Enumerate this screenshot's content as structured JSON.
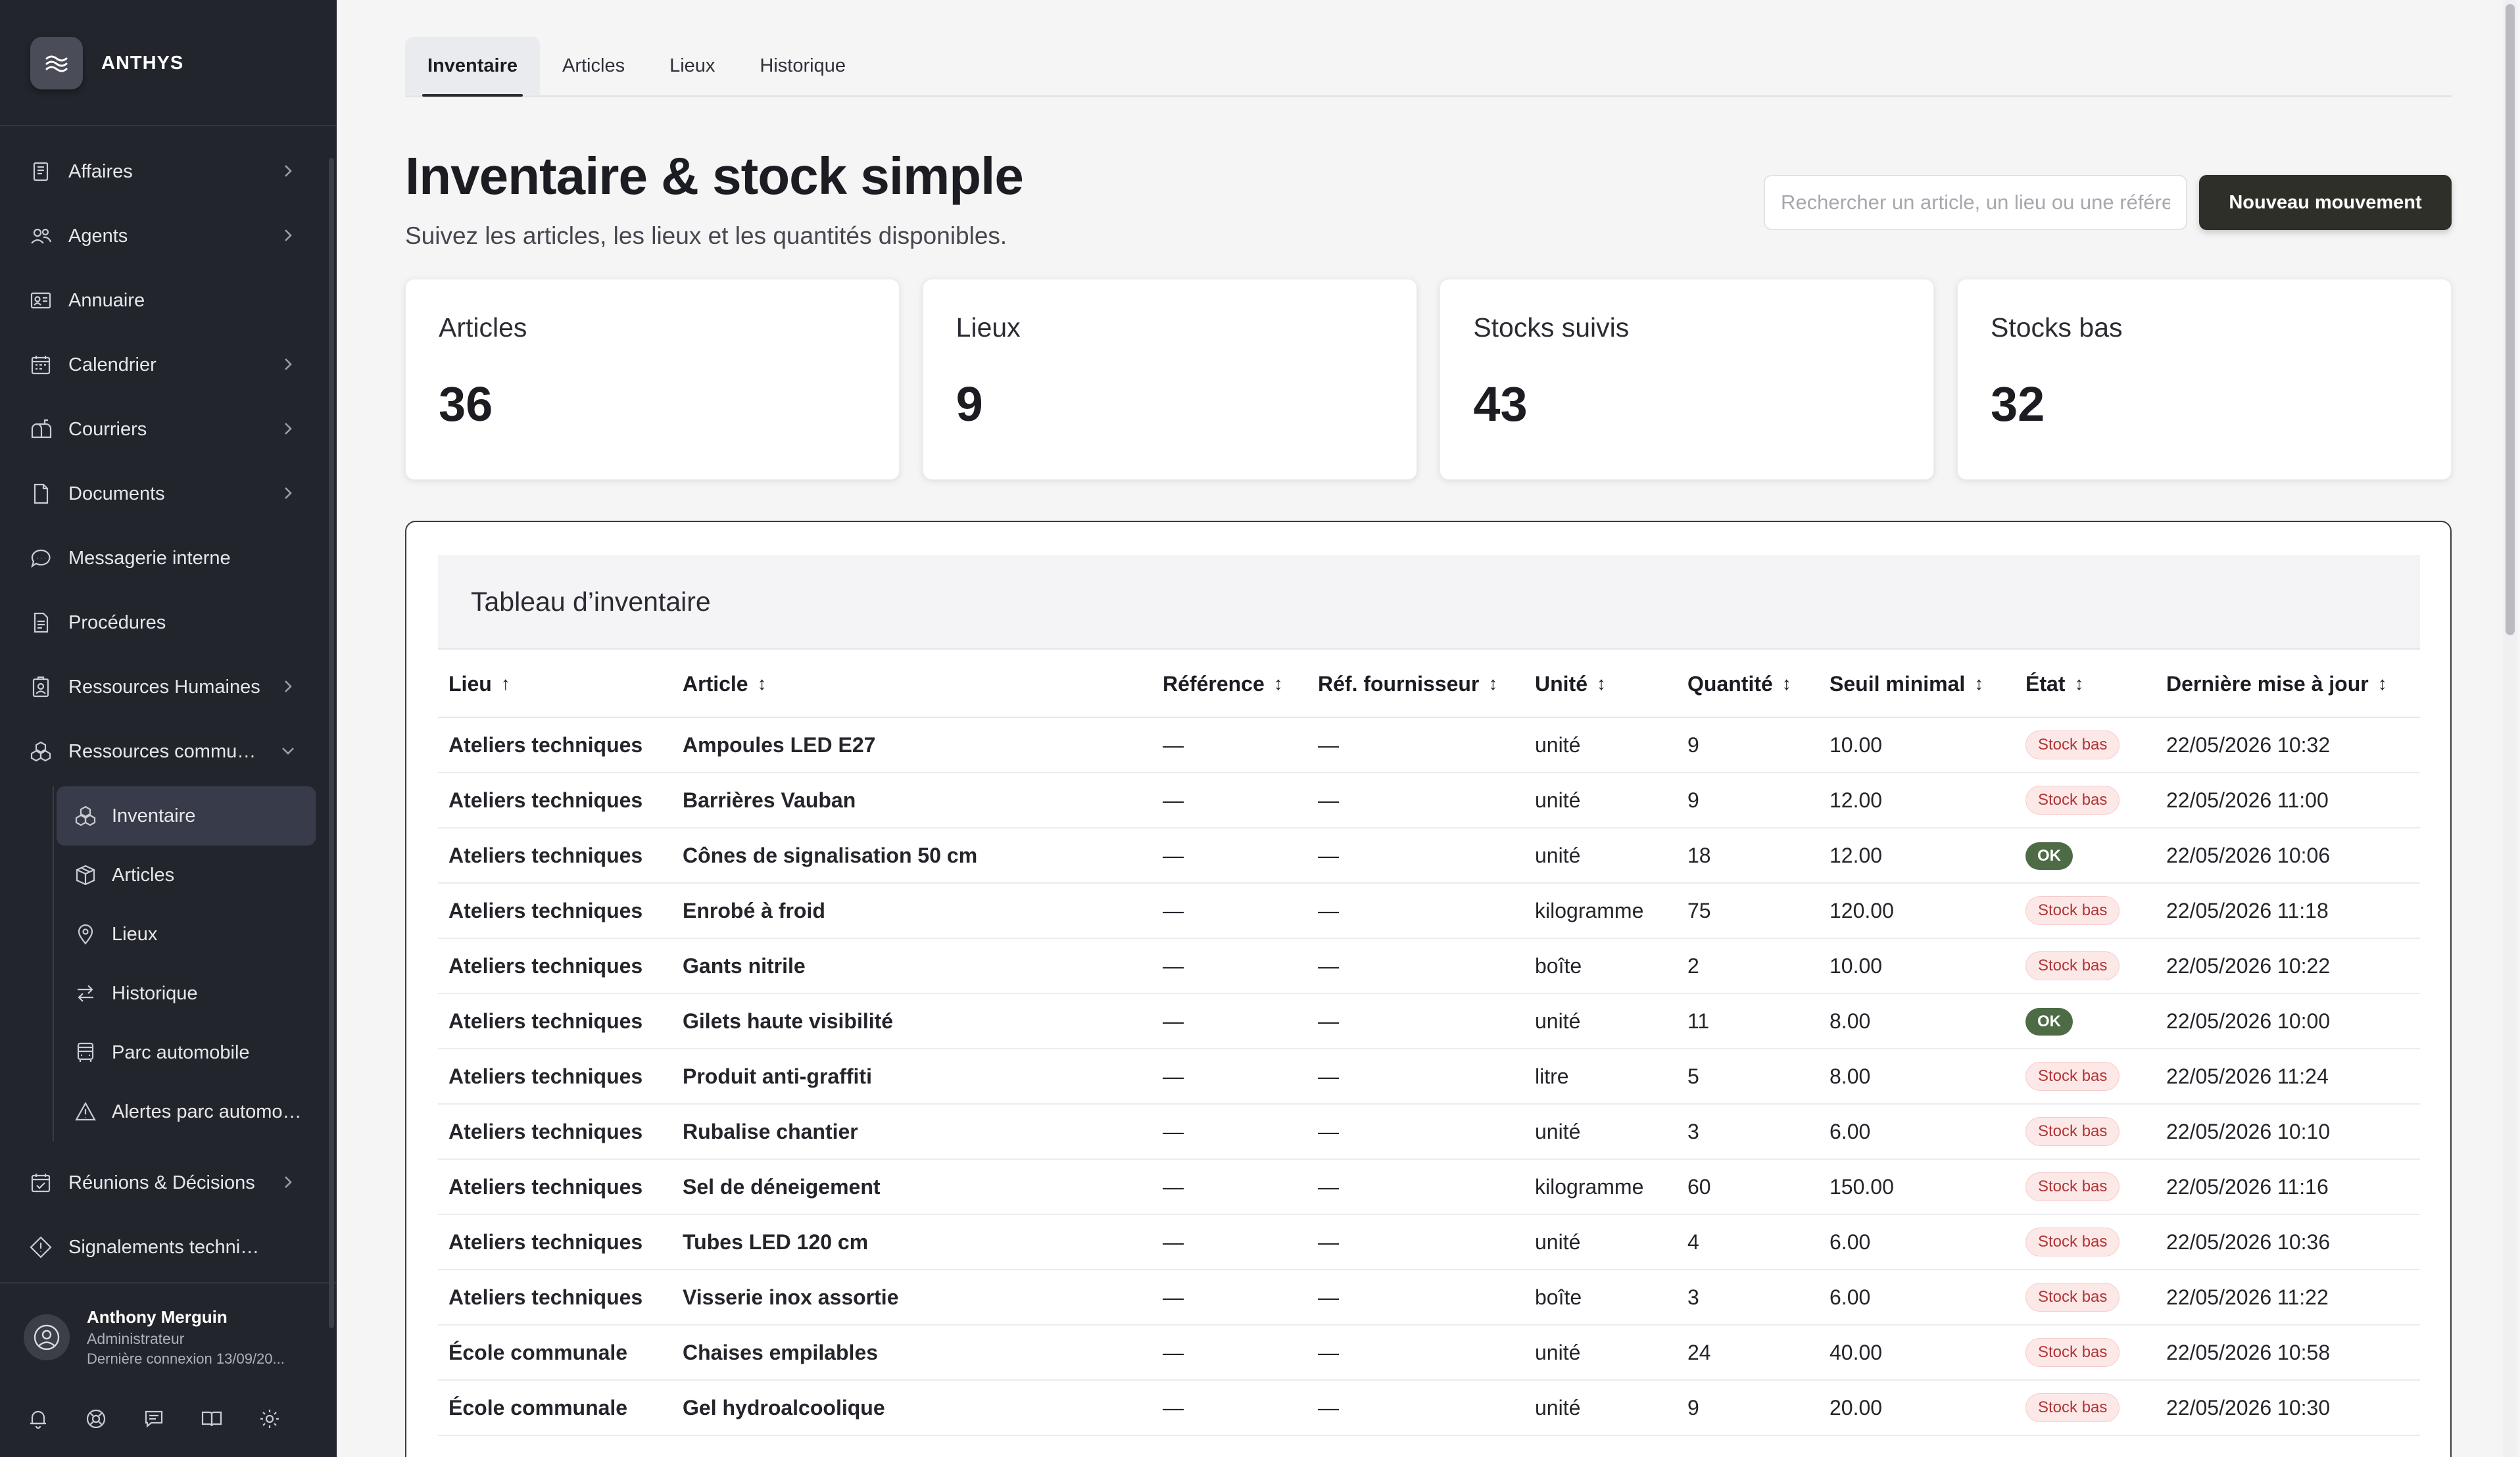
{
  "brand": {
    "name": "ANTHYS",
    "logo_icon": "waves-icon"
  },
  "nav": {
    "items": [
      {
        "label": "Affaires",
        "icon": "ledger-icon",
        "chevron": true
      },
      {
        "label": "Agents",
        "icon": "users-icon",
        "chevron": true
      },
      {
        "label": "Annuaire",
        "icon": "contact-card-icon",
        "chevron": false
      },
      {
        "label": "Calendrier",
        "icon": "calendar-icon",
        "chevron": true
      },
      {
        "label": "Courriers",
        "icon": "mailbox-icon",
        "chevron": true
      },
      {
        "label": "Documents",
        "icon": "document-icon",
        "chevron": true
      },
      {
        "label": "Messagerie interne",
        "icon": "chat-icon",
        "chevron": false
      },
      {
        "label": "Procédures",
        "icon": "procedure-icon",
        "chevron": false
      },
      {
        "label": "Ressources Humaines",
        "icon": "badge-icon",
        "chevron": true
      },
      {
        "label": "Ressources communales",
        "icon": "boxes-icon",
        "chevron": "down"
      }
    ],
    "sub_items": [
      {
        "label": "Inventaire",
        "icon": "boxes-icon",
        "active": true
      },
      {
        "label": "Articles",
        "icon": "package-icon",
        "active": false
      },
      {
        "label": "Lieux",
        "icon": "map-pin-icon",
        "active": false
      },
      {
        "label": "Historique",
        "icon": "arrows-swap-icon",
        "active": false
      },
      {
        "label": "Parc automobile",
        "icon": "bus-icon",
        "active": false
      },
      {
        "label": "Alertes parc automobile",
        "icon": "warning-icon",
        "active": false
      }
    ],
    "bottom_items": [
      {
        "label": "Réunions & Décisions",
        "icon": "calendar-check-icon",
        "chevron": true
      },
      {
        "label": "Signalements techniques",
        "icon": "diamond-alert-icon",
        "chevron": false
      }
    ]
  },
  "user": {
    "name": "Anthony Merguin",
    "role": "Administrateur",
    "last_login": "Dernière connexion 13/09/20..."
  },
  "side_tools": [
    "bell-icon",
    "lifebuoy-icon",
    "message-icon",
    "book-icon",
    "gear-icon"
  ],
  "tabs": [
    {
      "label": "Inventaire",
      "active": true
    },
    {
      "label": "Articles",
      "active": false
    },
    {
      "label": "Lieux",
      "active": false
    },
    {
      "label": "Historique",
      "active": false
    }
  ],
  "header": {
    "title": "Inventaire & stock simple",
    "subtitle": "Suivez les articles, les lieux et les quantités disponibles.",
    "search_placeholder": "Rechercher un article, un lieu ou une référence",
    "new_button": "Nouveau mouvement"
  },
  "stats": [
    {
      "label": "Articles",
      "value": "36"
    },
    {
      "label": "Lieux",
      "value": "9"
    },
    {
      "label": "Stocks suivis",
      "value": "43"
    },
    {
      "label": "Stocks bas",
      "value": "32"
    }
  ],
  "table": {
    "title": "Tableau d’inventaire",
    "columns": [
      {
        "label": "Lieu",
        "sort": "↑"
      },
      {
        "label": "Article",
        "sort": "↕"
      },
      {
        "label": "Référence",
        "sort": "↕"
      },
      {
        "label": "Réf. fournisseur",
        "sort": "↕"
      },
      {
        "label": "Unité",
        "sort": "↕"
      },
      {
        "label": "Quantité",
        "sort": "↕"
      },
      {
        "label": "Seuil minimal",
        "sort": "↕"
      },
      {
        "label": "État",
        "sort": "↕"
      },
      {
        "label": "Dernière mise à jour",
        "sort": "↕"
      }
    ],
    "rows": [
      [
        "Ateliers techniques",
        "Ampoules LED E27",
        "—",
        "—",
        "unité",
        "9",
        "10.00",
        "Stock bas",
        "22/05/2026 10:32"
      ],
      [
        "Ateliers techniques",
        "Barrières Vauban",
        "—",
        "—",
        "unité",
        "9",
        "12.00",
        "Stock bas",
        "22/05/2026 11:00"
      ],
      [
        "Ateliers techniques",
        "Cônes de signalisation 50 cm",
        "—",
        "—",
        "unité",
        "18",
        "12.00",
        "OK",
        "22/05/2026 10:06"
      ],
      [
        "Ateliers techniques",
        "Enrobé à froid",
        "—",
        "—",
        "kilogramme",
        "75",
        "120.00",
        "Stock bas",
        "22/05/2026 11:18"
      ],
      [
        "Ateliers techniques",
        "Gants nitrile",
        "—",
        "—",
        "boîte",
        "2",
        "10.00",
        "Stock bas",
        "22/05/2026 10:22"
      ],
      [
        "Ateliers techniques",
        "Gilets haute visibilité",
        "—",
        "—",
        "unité",
        "11",
        "8.00",
        "OK",
        "22/05/2026 10:00"
      ],
      [
        "Ateliers techniques",
        "Produit anti-graffiti",
        "—",
        "—",
        "litre",
        "5",
        "8.00",
        "Stock bas",
        "22/05/2026 11:24"
      ],
      [
        "Ateliers techniques",
        "Rubalise chantier",
        "—",
        "—",
        "unité",
        "3",
        "6.00",
        "Stock bas",
        "22/05/2026 10:10"
      ],
      [
        "Ateliers techniques",
        "Sel de déneigement",
        "—",
        "—",
        "kilogramme",
        "60",
        "150.00",
        "Stock bas",
        "22/05/2026 11:16"
      ],
      [
        "Ateliers techniques",
        "Tubes LED 120 cm",
        "—",
        "—",
        "unité",
        "4",
        "6.00",
        "Stock bas",
        "22/05/2026 10:36"
      ],
      [
        "Ateliers techniques",
        "Visserie inox assortie",
        "—",
        "—",
        "boîte",
        "3",
        "6.00",
        "Stock bas",
        "22/05/2026 11:22"
      ],
      [
        "École communale",
        "Chaises empilables",
        "—",
        "—",
        "unité",
        "24",
        "40.00",
        "Stock bas",
        "22/05/2026 10:58"
      ],
      [
        "École communale",
        "Gel hydroalcoolique",
        "—",
        "—",
        "unité",
        "9",
        "20.00",
        "Stock bas",
        "22/05/2026 10:30"
      ]
    ]
  },
  "colors": {
    "sidebar": "#23252d",
    "primary_button": "#2f2f2a",
    "ok_badge": "#4d6b45",
    "low_badge_text": "#b23434"
  }
}
